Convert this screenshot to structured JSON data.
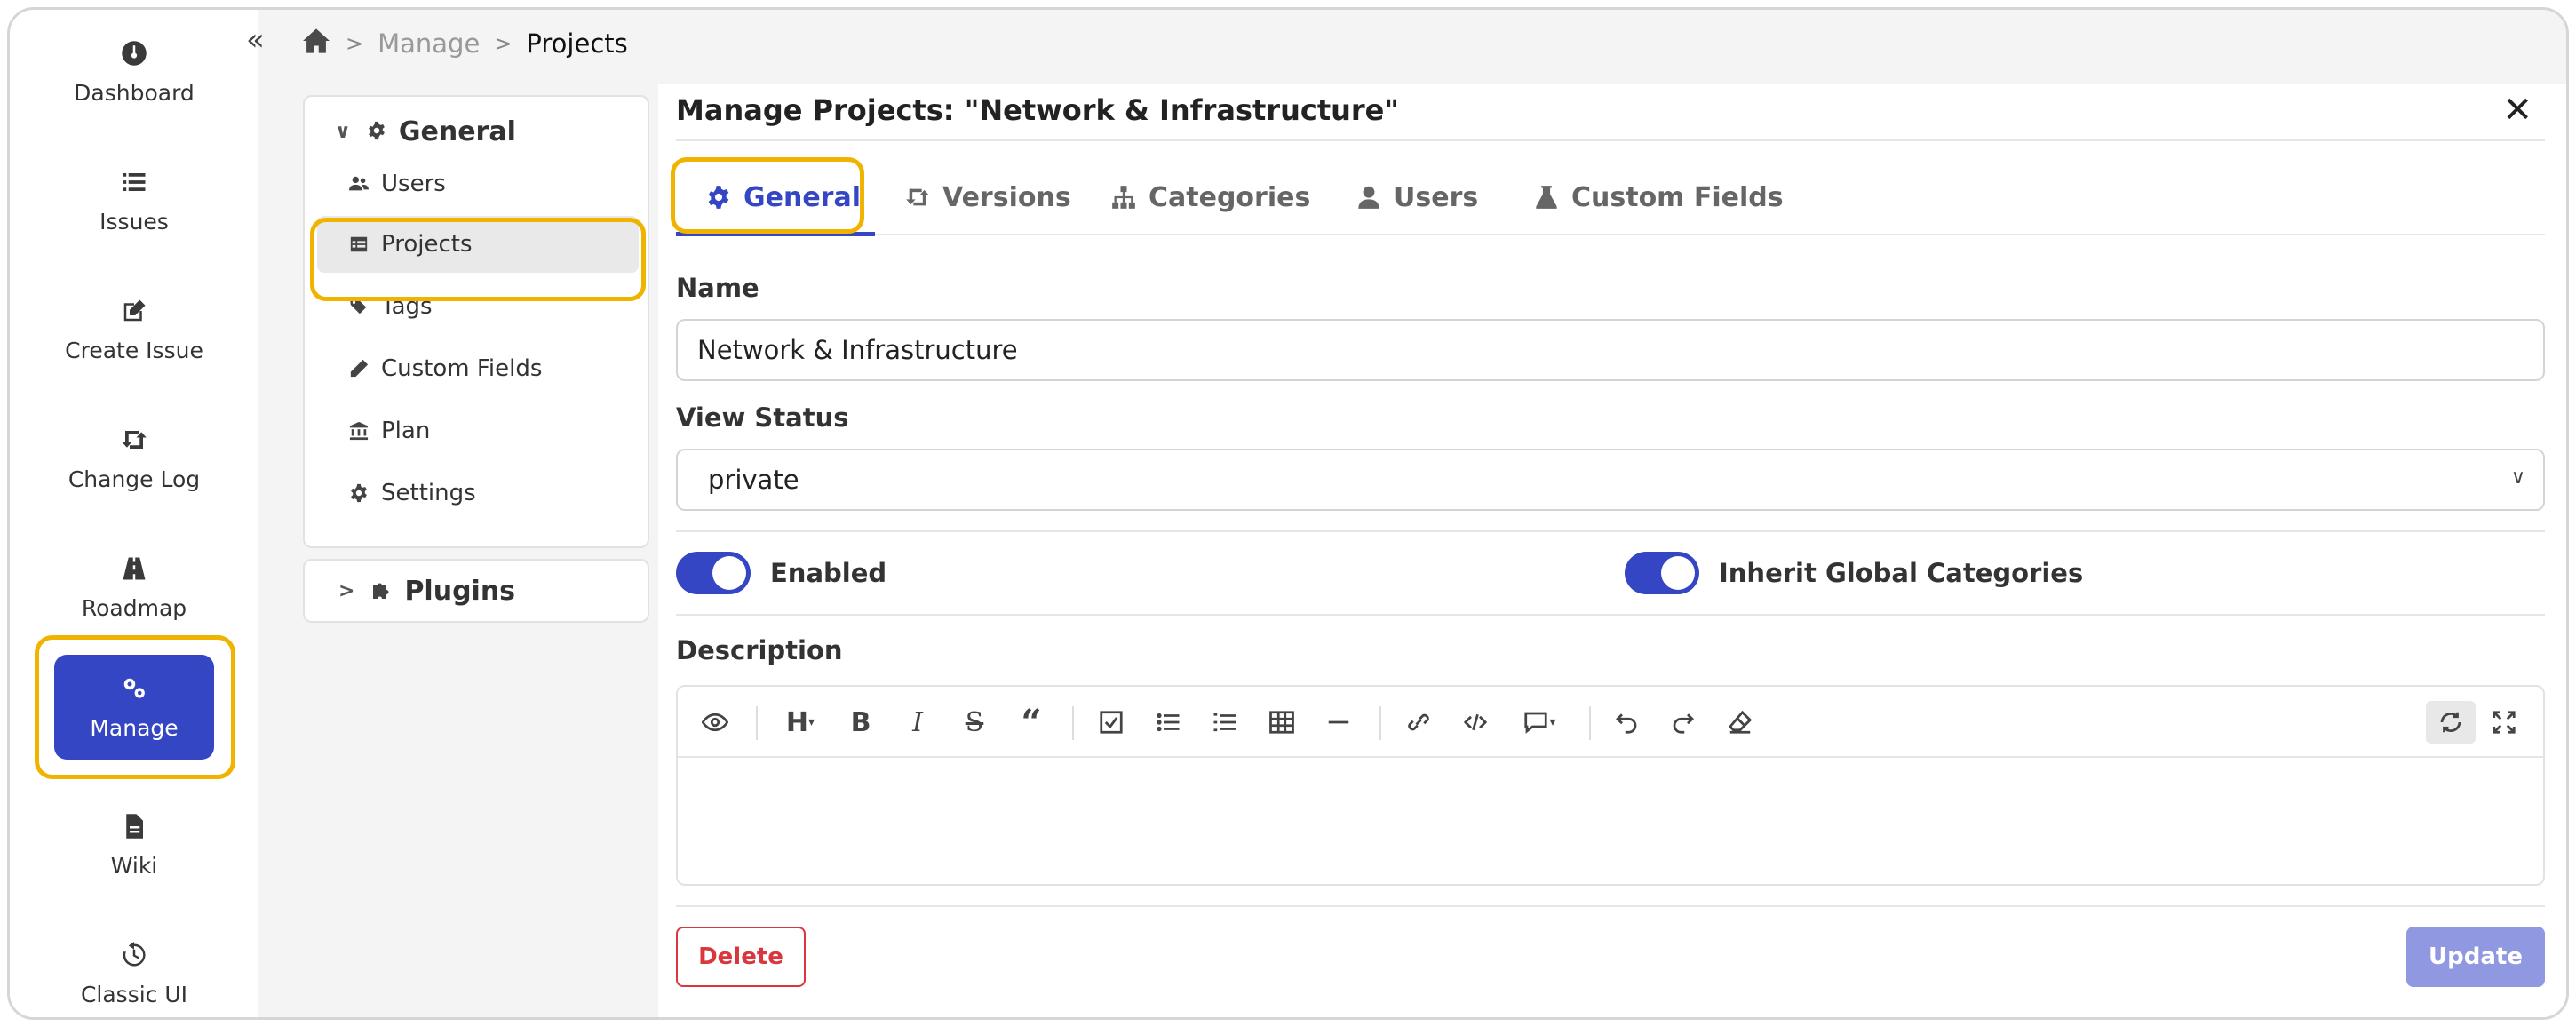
{
  "nav": {
    "items": [
      {
        "label": "Dashboard",
        "icon": "dashboard-icon"
      },
      {
        "label": "Issues",
        "icon": "list-icon"
      },
      {
        "label": "Create Issue",
        "icon": "edit-icon"
      },
      {
        "label": "Change Log",
        "icon": "changelog-icon"
      },
      {
        "label": "Roadmap",
        "icon": "road-icon"
      },
      {
        "label": "Manage",
        "icon": "gears-icon",
        "active": true
      },
      {
        "label": "Wiki",
        "icon": "document-icon"
      },
      {
        "label": "Classic UI",
        "icon": "history-icon"
      }
    ]
  },
  "breadcrumb": {
    "parent": "Manage",
    "current": "Projects"
  },
  "sidemenu": {
    "group": "General",
    "items": [
      {
        "label": "Users"
      },
      {
        "label": "Projects",
        "active": true
      },
      {
        "label": "Tags"
      },
      {
        "label": "Custom Fields"
      },
      {
        "label": "Plan"
      },
      {
        "label": "Settings"
      }
    ],
    "plugins": "Plugins"
  },
  "panel": {
    "title": "Manage Projects: \"Network & Infrastructure\"",
    "tabs": [
      {
        "label": "General",
        "icon": "gear-icon",
        "active": true
      },
      {
        "label": "Versions",
        "icon": "versions-icon"
      },
      {
        "label": "Categories",
        "icon": "sitemap-icon"
      },
      {
        "label": "Users",
        "icon": "user-icon"
      },
      {
        "label": "Custom Fields",
        "icon": "flask-icon"
      }
    ],
    "name_label": "Name",
    "name_value": "Network & Infrastructure",
    "view_status_label": "View Status",
    "view_status_value": "private",
    "enabled_label": "Enabled",
    "enabled_on": true,
    "inherit_label": "Inherit Global Categories",
    "inherit_on": true,
    "description_label": "Description",
    "delete_label": "Delete",
    "update_label": "Update"
  },
  "colors": {
    "accent": "#3446c4",
    "highlight": "#f0b400",
    "danger": "#d9363e",
    "update_disabled": "#8f98e0"
  }
}
